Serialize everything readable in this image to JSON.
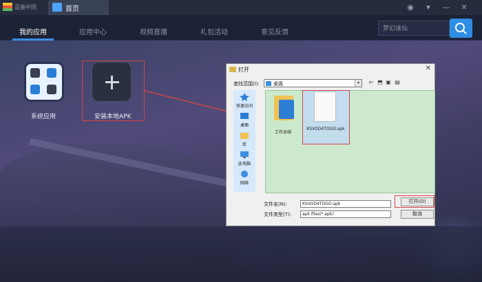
{
  "titlebar": {
    "app_name": "蓝叠中国",
    "home_tab": "首页",
    "user_icon": "user-icon",
    "menu_icon": "menu-icon",
    "minimize_icon": "minimize-icon",
    "close_icon": "close-icon"
  },
  "nav": {
    "items": [
      {
        "label": "我的应用",
        "active": true
      },
      {
        "label": "应用中心",
        "active": false
      },
      {
        "label": "视频直播",
        "active": false
      },
      {
        "label": "礼包活动",
        "active": false
      },
      {
        "label": "意见反馈",
        "active": false
      }
    ],
    "search_placeholder": "梦幻诛仙",
    "accent": "#2f8de4"
  },
  "apps": [
    {
      "label": "系统应用",
      "icon": "system-apps-icon"
    },
    {
      "label": "安装本地APK",
      "icon": "plus-icon"
    }
  ],
  "dialog": {
    "title": "打开",
    "look_in_label": "查找范围(I):",
    "look_in_value": "桌面",
    "places": [
      "快速访问",
      "桌面",
      "库",
      "此电脑",
      "网络"
    ],
    "files": [
      {
        "name": "工作总结",
        "type": "folder"
      },
      {
        "name": "KSVOD4TOGO.apk",
        "type": "file"
      }
    ],
    "filename_label": "文件名(N):",
    "filename_value": "KSVOD4TOGO.apk",
    "filetype_label": "文件类型(T):",
    "filetype_value": "apk files(*.apk)",
    "open_button": "打开(O)",
    "cancel_button": "取消"
  },
  "highlight_color": "#d04545"
}
